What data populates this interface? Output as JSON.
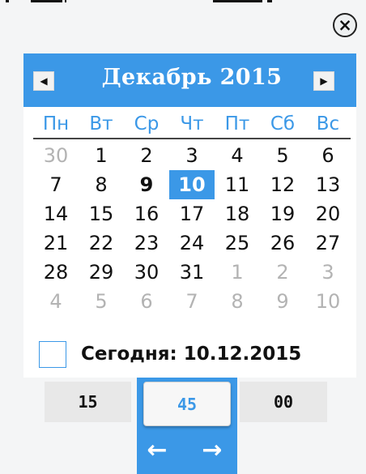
{
  "calendar": {
    "month_title": "Декабрь 2015",
    "weekdays": [
      "Пн",
      "Вт",
      "Ср",
      "Чт",
      "Пт",
      "Сб",
      "Вс"
    ],
    "weeks": [
      [
        {
          "text": "30",
          "state": "other"
        },
        {
          "text": "1",
          "state": "normal"
        },
        {
          "text": "2",
          "state": "normal"
        },
        {
          "text": "3",
          "state": "normal"
        },
        {
          "text": "4",
          "state": "normal"
        },
        {
          "text": "5",
          "state": "normal"
        },
        {
          "text": "6",
          "state": "normal"
        }
      ],
      [
        {
          "text": "7",
          "state": "normal"
        },
        {
          "text": "8",
          "state": "normal"
        },
        {
          "text": "9",
          "state": "today"
        },
        {
          "text": "10",
          "state": "selected"
        },
        {
          "text": "11",
          "state": "normal"
        },
        {
          "text": "12",
          "state": "normal"
        },
        {
          "text": "13",
          "state": "normal"
        }
      ],
      [
        {
          "text": "14",
          "state": "normal"
        },
        {
          "text": "15",
          "state": "normal"
        },
        {
          "text": "16",
          "state": "normal"
        },
        {
          "text": "17",
          "state": "normal"
        },
        {
          "text": "18",
          "state": "normal"
        },
        {
          "text": "19",
          "state": "normal"
        },
        {
          "text": "20",
          "state": "normal"
        }
      ],
      [
        {
          "text": "21",
          "state": "normal"
        },
        {
          "text": "22",
          "state": "normal"
        },
        {
          "text": "23",
          "state": "normal"
        },
        {
          "text": "24",
          "state": "normal"
        },
        {
          "text": "25",
          "state": "normal"
        },
        {
          "text": "26",
          "state": "normal"
        },
        {
          "text": "27",
          "state": "normal"
        }
      ],
      [
        {
          "text": "28",
          "state": "normal"
        },
        {
          "text": "29",
          "state": "normal"
        },
        {
          "text": "30",
          "state": "normal"
        },
        {
          "text": "31",
          "state": "normal"
        },
        {
          "text": "1",
          "state": "other"
        },
        {
          "text": "2",
          "state": "other"
        },
        {
          "text": "3",
          "state": "other"
        }
      ],
      [
        {
          "text": "4",
          "state": "other"
        },
        {
          "text": "5",
          "state": "other"
        },
        {
          "text": "6",
          "state": "other"
        },
        {
          "text": "7",
          "state": "other"
        },
        {
          "text": "8",
          "state": "other"
        },
        {
          "text": "9",
          "state": "other"
        },
        {
          "text": "10",
          "state": "other"
        }
      ]
    ],
    "today_label": "Сегодня: 10.12.2015"
  },
  "time": {
    "hour": "15",
    "minute": "45",
    "second": "00"
  },
  "icons": {
    "close": "close-icon",
    "prev": "triangle-left-icon",
    "next": "triangle-right-icon",
    "back": "arrow-left-icon",
    "forward": "arrow-right-icon"
  },
  "colors": {
    "accent": "#3b98e7",
    "muted_day": "#b3b3b3",
    "text": "#111111",
    "background": "#f4f5f6"
  }
}
